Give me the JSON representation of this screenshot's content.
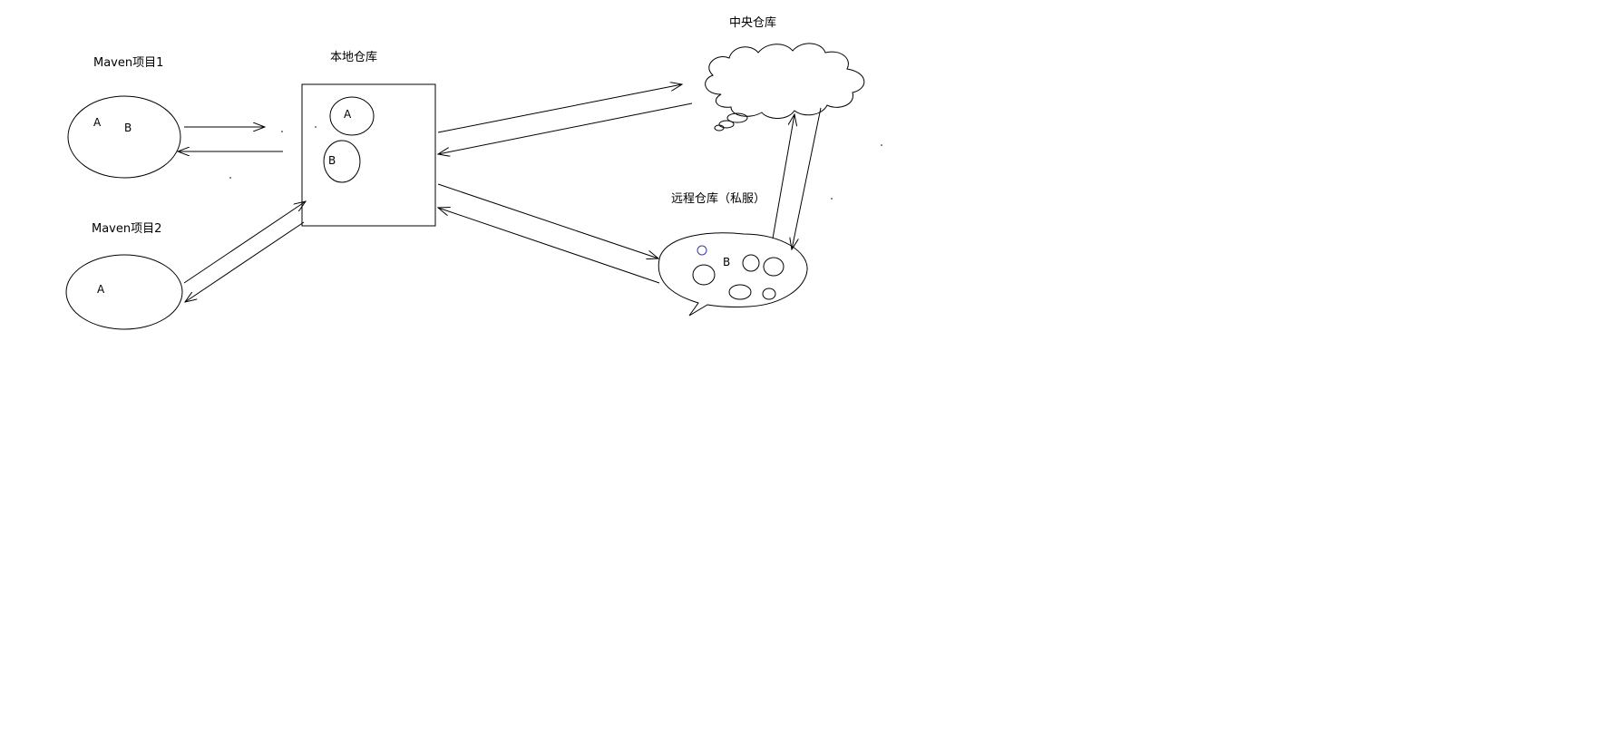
{
  "diagram": {
    "labels": {
      "project1": "Maven项目1",
      "project2": "Maven项目2",
      "local_repo": "本地仓库",
      "central_repo": "中央仓库",
      "remote_repo": "远程仓库（私服）"
    },
    "project1_items": [
      "A",
      "B"
    ],
    "project2_items": [
      "A"
    ],
    "local_repo_items": [
      "A",
      "B"
    ],
    "remote_repo_items": [
      "B"
    ],
    "colors": {
      "stroke": "#000000",
      "accent_circle": "#3a3aa8",
      "background": "#ffffff"
    }
  }
}
